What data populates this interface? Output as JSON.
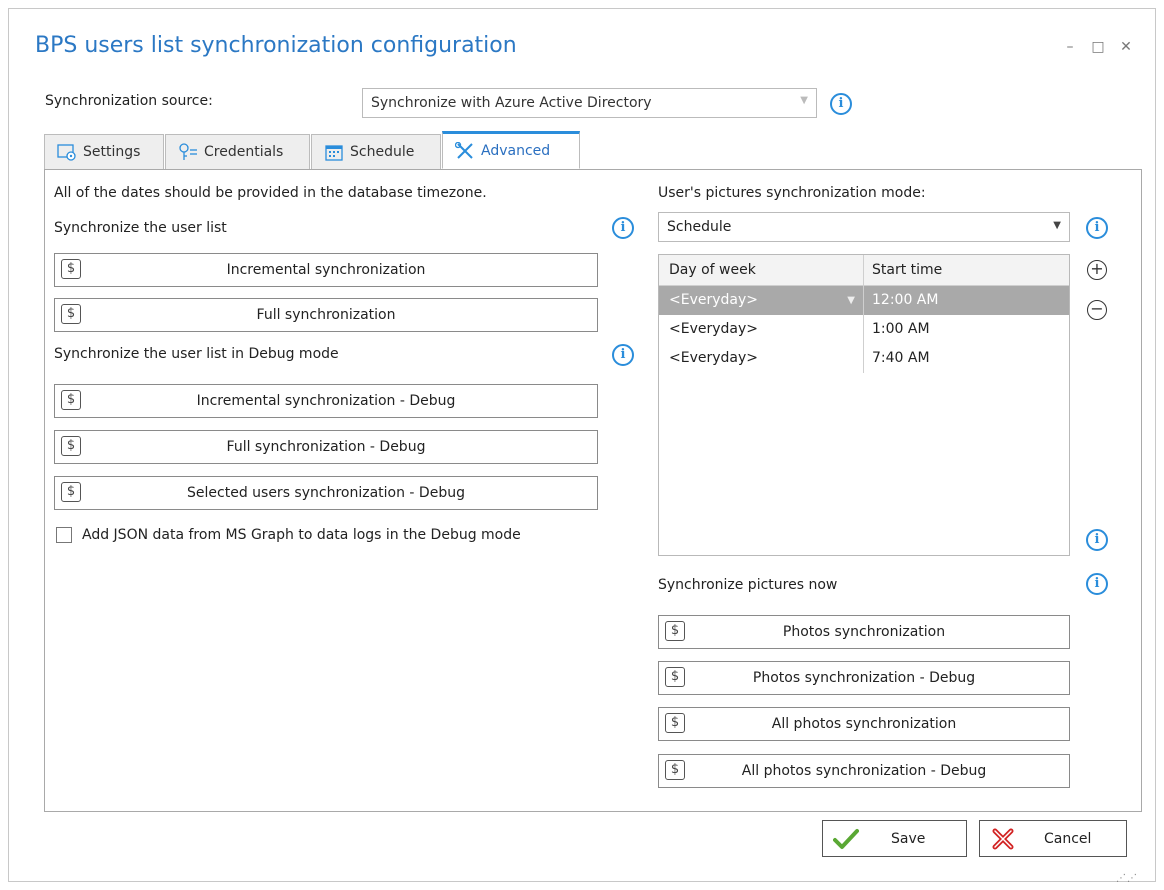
{
  "window": {
    "title": "BPS users list synchronization configuration",
    "controls": {
      "minimize": "–",
      "maximize": "□",
      "close": "✕"
    }
  },
  "source": {
    "label": "Synchronization source:",
    "value": "Synchronize with Azure Active Directory"
  },
  "tabs": [
    {
      "label": "Settings",
      "icon": "settings-icon",
      "active": false
    },
    {
      "label": "Credentials",
      "icon": "key-icon",
      "active": false
    },
    {
      "label": "Schedule",
      "icon": "calendar-icon",
      "active": false
    },
    {
      "label": "Advanced",
      "icon": "tools-icon",
      "active": true
    }
  ],
  "advanced": {
    "timezone_note": "All of the dates should be provided in the database timezone.",
    "sync_user_list_label": "Synchronize the user list",
    "sync_buttons": [
      "Incremental synchronization",
      "Full synchronization"
    ],
    "debug_label": "Synchronize the user list in Debug mode",
    "debug_buttons": [
      "Incremental synchronization - Debug",
      "Full synchronization - Debug",
      "Selected users synchronization - Debug"
    ],
    "json_checkbox_label": "Add JSON data from MS Graph to data logs in the Debug mode",
    "json_checkbox_checked": false,
    "pictures_mode_label": "User's pictures synchronization mode:",
    "pictures_mode_value": "Schedule",
    "grid": {
      "headers": [
        "Day of week",
        "Start time"
      ],
      "rows": [
        {
          "day": "<Everyday>",
          "time": "12:00 AM",
          "selected": true
        },
        {
          "day": "<Everyday>",
          "time": "1:00 AM",
          "selected": false
        },
        {
          "day": "<Everyday>",
          "time": "7:40 AM",
          "selected": false
        }
      ]
    },
    "pictures_now_label": "Synchronize pictures now",
    "picture_buttons": [
      "Photos synchronization",
      "Photos synchronization - Debug",
      "All photos synchronization",
      "All photos synchronization - Debug"
    ]
  },
  "footer": {
    "save_label": "Save",
    "cancel_label": "Cancel"
  },
  "colors": {
    "accent": "#2a8ddb",
    "title": "#2b78c4",
    "selected_row": "#a9a9a9",
    "save_icon": "#5aa834",
    "cancel_icon": "#d22222"
  }
}
